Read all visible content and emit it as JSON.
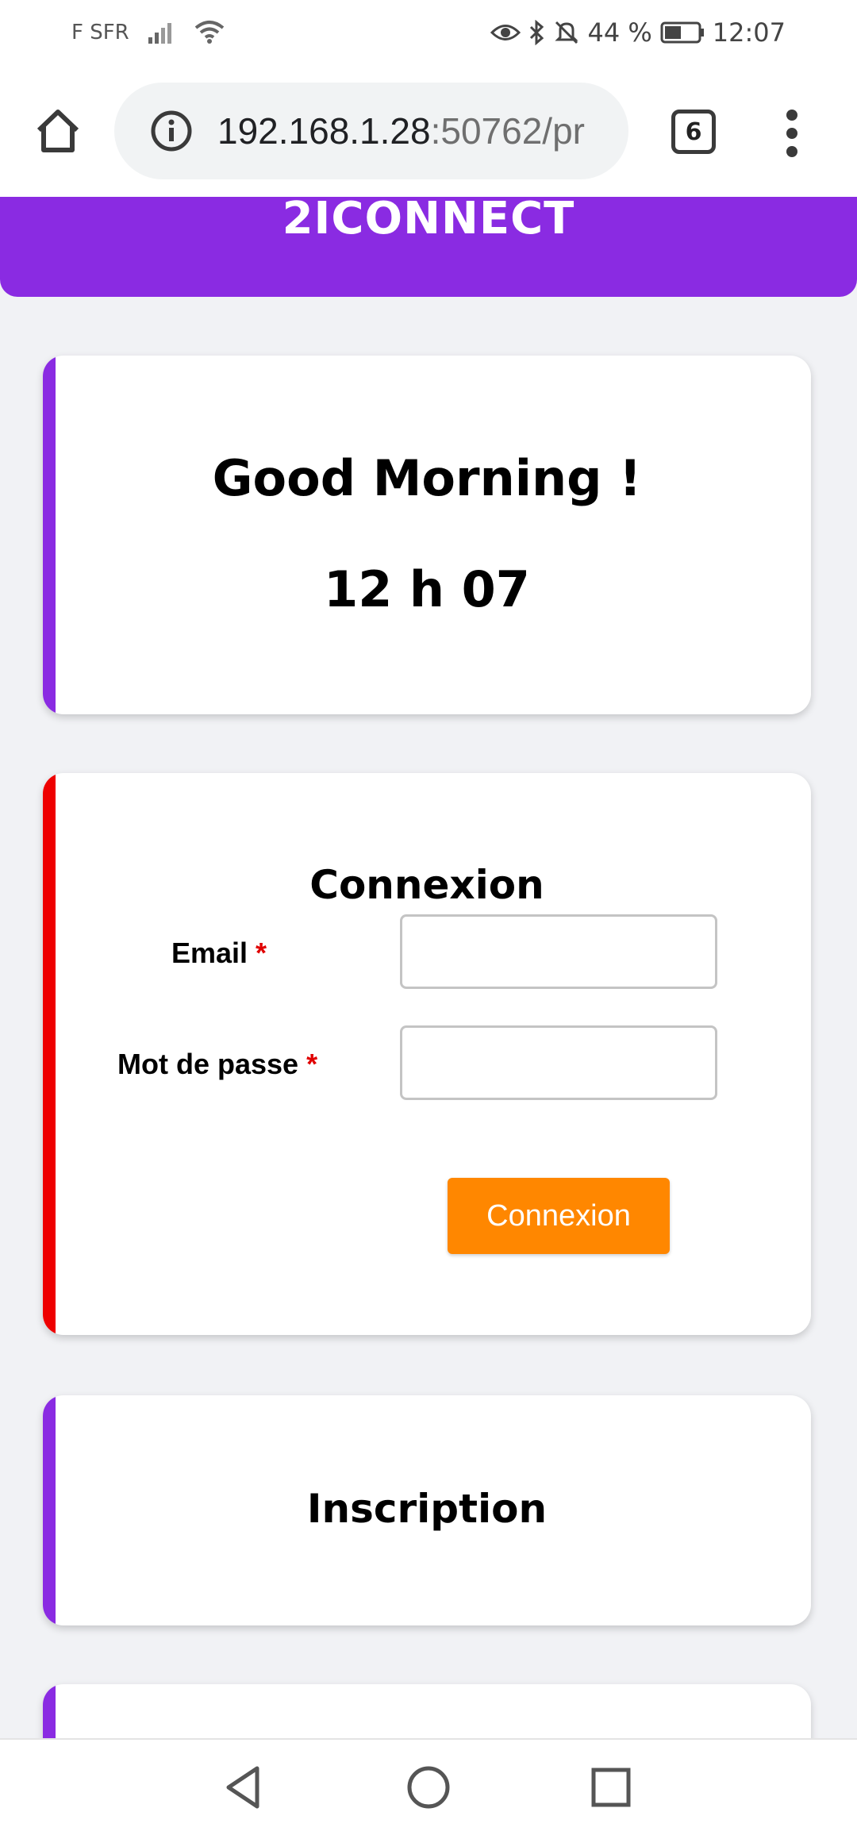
{
  "status_bar": {
    "carrier": "F SFR",
    "battery": "44 %",
    "time": "12:07",
    "icons": [
      "signal-icon",
      "wifi-icon",
      "eye-icon",
      "bluetooth-icon",
      "mute-icon",
      "battery-icon"
    ]
  },
  "browser": {
    "url_host": "192.168.1.28",
    "url_rest": ":50762/pr",
    "tab_count": "6"
  },
  "header": {
    "title": "2ICONNECT",
    "color": "#8a2be2"
  },
  "greeting_card": {
    "greeting": "Good Morning !",
    "clock": "12 h 07"
  },
  "login_card": {
    "title": "Connexion",
    "email_label": "Email",
    "password_label": "Mot de passe",
    "required_mark": "*",
    "email_value": "",
    "password_value": "",
    "submit_label": "Connexion",
    "button_color": "#ff8700",
    "accent_color": "#ee0000"
  },
  "signup_card": {
    "title": "Inscription"
  }
}
